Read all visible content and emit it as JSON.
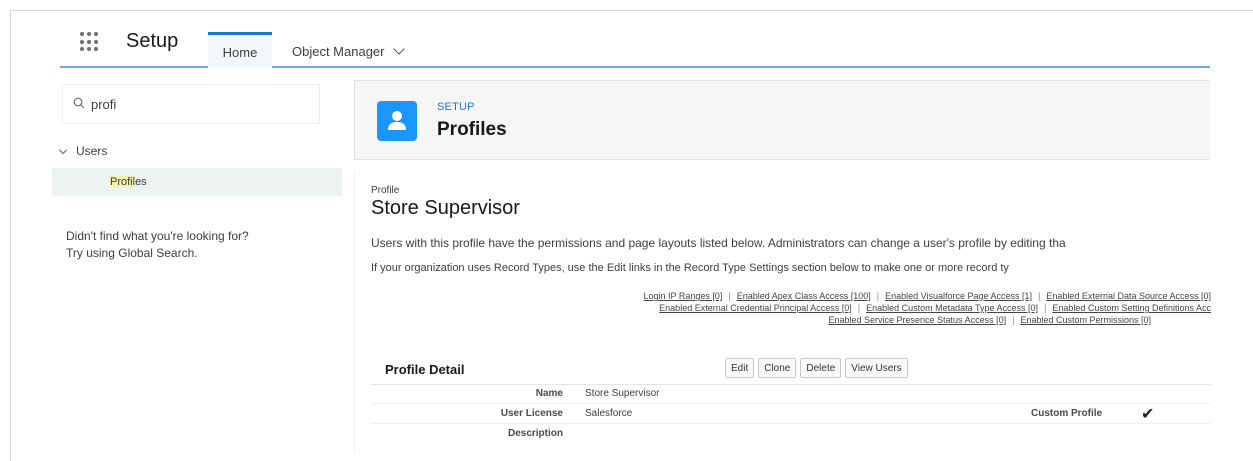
{
  "nav": {
    "app_name": "Setup",
    "tabs": [
      {
        "label": "Home",
        "active": true
      },
      {
        "label": "Object Manager",
        "active": false
      }
    ]
  },
  "sidebar": {
    "search": {
      "value": "profi",
      "icon": "search-icon"
    },
    "tree": {
      "group_label": "Users",
      "item_label_highlight": "Profi",
      "item_label_rest": "les"
    },
    "help_line1": "Didn't find what you're looking for?",
    "help_line2": "Try using Global Search."
  },
  "header": {
    "eyebrow": "SETUP",
    "title": "Profiles",
    "icon": "user-icon",
    "icon_color": "#1b96ff"
  },
  "profile": {
    "breadcrumb": "Profile",
    "name": "Store Supervisor",
    "para1": "Users with this profile have the permissions and page layouts listed below. Administrators can change a user's profile by editing tha",
    "para2": "If your organization uses Record Types, use the Edit links in the Record Type Settings section below to make one or more record ty",
    "links": {
      "row1": [
        "Login IP Ranges [0]",
        "Enabled Apex Class Access [100]",
        "Enabled Visualforce Page Access [1]",
        "Enabled External Data Source Access [0]"
      ],
      "row2": [
        "Enabled External Credential Principal Access [0]",
        "Enabled Custom Metadata Type Access [0]",
        "Enabled Custom Setting Definitions Acc"
      ],
      "row3": [
        "Enabled Service Presence Status Access [0]",
        "Enabled Custom Permissions [0]"
      ]
    },
    "detail": {
      "title": "Profile Detail",
      "buttons": [
        "Edit",
        "Clone",
        "Delete",
        "View Users"
      ],
      "name_label": "Name",
      "name_value": "Store Supervisor",
      "license_label": "User License",
      "license_value": "Salesforce",
      "custom_label": "Custom Profile",
      "description_label": "Description"
    }
  },
  "colors": {
    "accent": "#1b75d0",
    "nav_underline": "#6ea8dc",
    "highlight": "#f4f1a8"
  }
}
